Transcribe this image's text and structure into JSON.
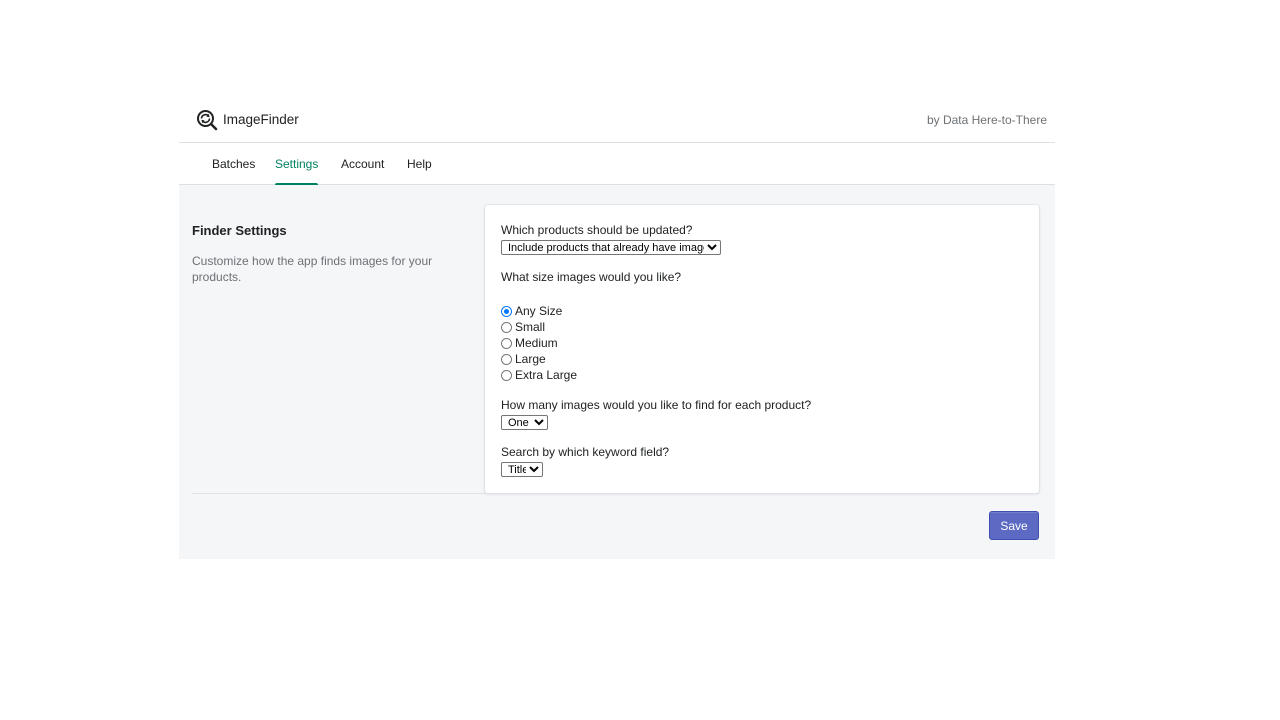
{
  "header": {
    "app_name": "ImageFinder",
    "byline": "by Data Here-to-There",
    "logo_icon": "magnifier-refresh-icon"
  },
  "nav": {
    "tabs": [
      {
        "label": "Batches",
        "active": false
      },
      {
        "label": "Settings",
        "active": true
      },
      {
        "label": "Account",
        "active": false
      },
      {
        "label": "Help",
        "active": false
      }
    ],
    "accent_color": "#008060"
  },
  "section": {
    "title": "Finder Settings",
    "description": "Customize how the app finds images for your products."
  },
  "form": {
    "products_question": "Which products should be updated?",
    "products_selected": "Include products that already have images",
    "size_question": "What size images would you like?",
    "size_options": [
      {
        "label": "Any Size",
        "checked": true
      },
      {
        "label": "Small",
        "checked": false
      },
      {
        "label": "Medium",
        "checked": false
      },
      {
        "label": "Large",
        "checked": false
      },
      {
        "label": "Extra Large",
        "checked": false
      }
    ],
    "count_question": "How many images would you like to find for each product?",
    "count_selected": "One",
    "keyword_question": "Search by which keyword field?",
    "keyword_selected": "Title"
  },
  "actions": {
    "save_label": "Save",
    "primary_color": "#5c6ac4"
  }
}
